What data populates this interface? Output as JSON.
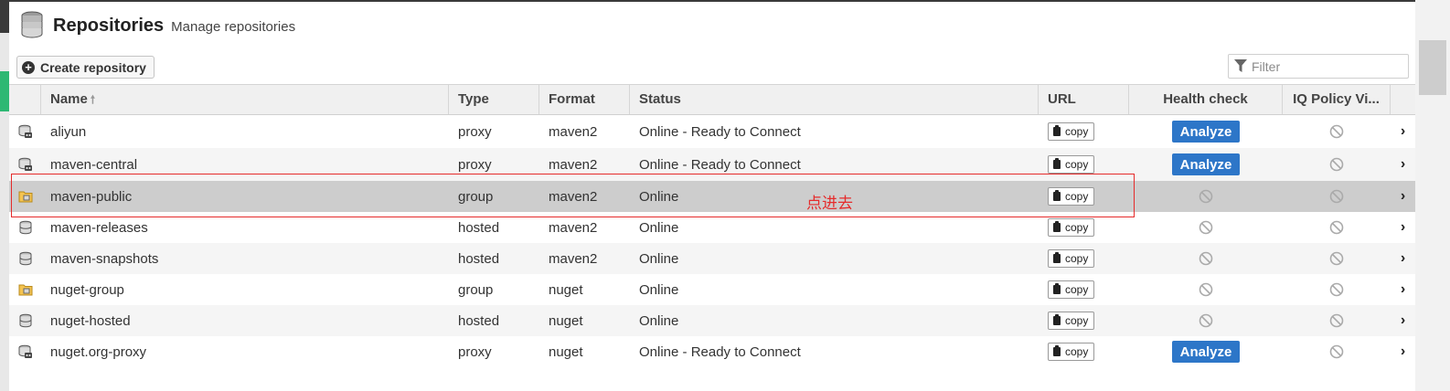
{
  "header": {
    "title": "Repositories",
    "subtitle": "Manage repositories",
    "title_icon": "database-stack-icon"
  },
  "toolbar": {
    "create_label": "Create repository",
    "filter_placeholder": "Filter"
  },
  "table": {
    "columns": {
      "name": "Name",
      "type": "Type",
      "format": "Format",
      "status": "Status",
      "url": "URL",
      "health": "Health check",
      "iq": "IQ Policy Vi..."
    },
    "rows": [
      {
        "icon": "proxy-repo-icon",
        "name": "aliyun",
        "type": "proxy",
        "format": "maven2",
        "status": "Online - Ready to Connect",
        "copy": "copy",
        "health": "Analyze",
        "iq": "disabled"
      },
      {
        "icon": "proxy-repo-icon",
        "name": "maven-central",
        "type": "proxy",
        "format": "maven2",
        "status": "Online - Ready to Connect",
        "copy": "copy",
        "health": "Analyze",
        "iq": "disabled"
      },
      {
        "icon": "group-repo-icon",
        "name": "maven-public",
        "type": "group",
        "format": "maven2",
        "status": "Online",
        "copy": "copy",
        "health": "disabled",
        "iq": "disabled"
      },
      {
        "icon": "hosted-repo-icon",
        "name": "maven-releases",
        "type": "hosted",
        "format": "maven2",
        "status": "Online",
        "copy": "copy",
        "health": "disabled",
        "iq": "disabled"
      },
      {
        "icon": "hosted-repo-icon",
        "name": "maven-snapshots",
        "type": "hosted",
        "format": "maven2",
        "status": "Online",
        "copy": "copy",
        "health": "disabled",
        "iq": "disabled"
      },
      {
        "icon": "group-repo-icon",
        "name": "nuget-group",
        "type": "group",
        "format": "nuget",
        "status": "Online",
        "copy": "copy",
        "health": "disabled",
        "iq": "disabled"
      },
      {
        "icon": "hosted-repo-icon",
        "name": "nuget-hosted",
        "type": "hosted",
        "format": "nuget",
        "status": "Online",
        "copy": "copy",
        "health": "disabled",
        "iq": "disabled"
      },
      {
        "icon": "proxy-repo-icon",
        "name": "nuget.org-proxy",
        "type": "proxy",
        "format": "nuget",
        "status": "Online - Ready to Connect",
        "copy": "copy",
        "health": "Analyze",
        "iq": "disabled"
      }
    ],
    "selected_index": 2
  },
  "annotation": {
    "text": "点进去",
    "color": "#e52b2b"
  },
  "colors": {
    "analyze": "#2d76c8",
    "selected_row": "#cdcdcd",
    "sidebar_accent": "#2eb873"
  }
}
